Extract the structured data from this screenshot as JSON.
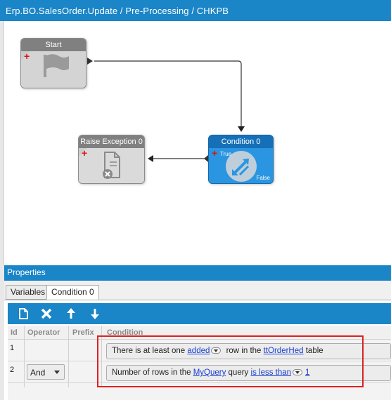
{
  "window": {
    "title": "Erp.BO.SalesOrder.Update / Pre-Processing / CHKPB"
  },
  "workflow": {
    "start_node": {
      "label": "Start"
    },
    "raise_node": {
      "label": "Raise Exception 0"
    },
    "condition_node": {
      "label": "Condition 0",
      "true_label": "True",
      "false_label": "False"
    }
  },
  "properties": {
    "title": "Properties",
    "tabs": [
      {
        "label": "Variables",
        "active": false
      },
      {
        "label": "Condition 0",
        "active": true
      }
    ],
    "toolbar": {
      "buttons": [
        "new-icon",
        "delete-icon",
        "move-up-icon",
        "move-down-icon"
      ]
    },
    "grid": {
      "columns": [
        "Id",
        "Operator",
        "Prefix",
        "Condition"
      ],
      "rows": [
        {
          "id": "1",
          "operator": "",
          "prefix": "",
          "condition": {
            "t1": "There is at least one ",
            "link1": "added",
            "t2": " row in the ",
            "link2": "ttOrderHed",
            "t3": " table"
          }
        },
        {
          "id": "2",
          "operator": "And",
          "prefix": "",
          "condition": {
            "t1": "Number of rows in the ",
            "link1": "MyQuery",
            "t2": " query ",
            "link2": "is less than",
            "t3": "1"
          }
        }
      ]
    }
  },
  "colors": {
    "accent_blue": "#1a85c7",
    "condition_node_blue": "#1d8ad6",
    "highlight_red": "#e02020",
    "link_blue": "#1a3fcf"
  }
}
